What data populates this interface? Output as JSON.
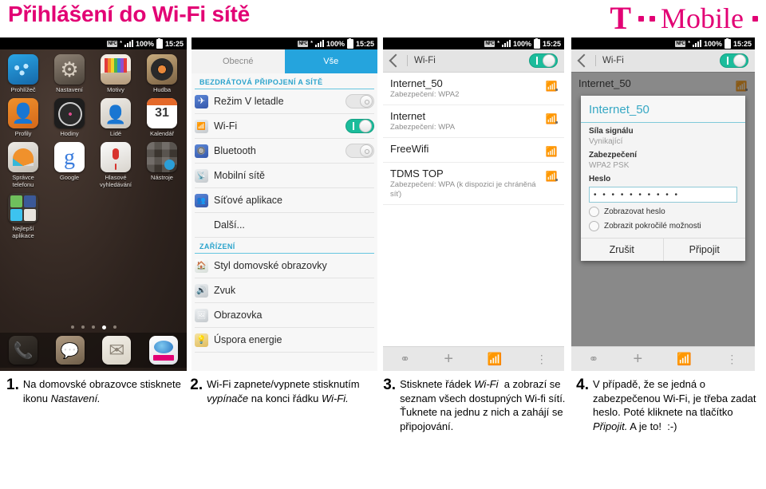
{
  "header": {
    "title": "Přihlášení do Wi-Fi sítě",
    "brand": {
      "letter": "T",
      "word": "Mobile"
    }
  },
  "statusbar": {
    "nfc": "NFC",
    "star": "*",
    "battery": "100%",
    "time": "15:25"
  },
  "phone1": {
    "apps": [
      {
        "label": "Prohlížeč",
        "icon": "browser-icon"
      },
      {
        "label": "Nastavení",
        "icon": "settings-icon"
      },
      {
        "label": "Motivy",
        "icon": "themes-icon"
      },
      {
        "label": "Hudba",
        "icon": "music-icon"
      },
      {
        "label": "Profily",
        "icon": "profiles-icon"
      },
      {
        "label": "Hodiny",
        "icon": "clock-icon"
      },
      {
        "label": "Lidé",
        "icon": "people-icon"
      },
      {
        "label": "Kalendář",
        "icon": "calendar-icon"
      },
      {
        "label": "Správce telefonu",
        "icon": "phone-manager-icon"
      },
      {
        "label": "Google",
        "icon": "google-icon"
      },
      {
        "label": "Hlasové vyhledávání",
        "icon": "voice-search-icon"
      },
      {
        "label": "Nástroje",
        "icon": "tools-folder-icon"
      },
      {
        "label": "Nejlepší aplikace",
        "icon": "best-apps-folder-icon"
      }
    ],
    "dock": [
      "phone-icon",
      "messages-icon",
      "mail-icon",
      "store-icon"
    ],
    "page_dots": 5,
    "active_dot": 4
  },
  "phone2": {
    "tabs": [
      {
        "label": "Obecné",
        "active": false
      },
      {
        "label": "Vše",
        "active": true
      }
    ],
    "sections": [
      {
        "title": "BEZDRÁTOVÁ PŘIPOJENÍ A SÍTĚ",
        "rows": [
          {
            "label": "Režim V letadle",
            "icon": "airplane-icon",
            "toggle": "off"
          },
          {
            "label": "Wi-Fi",
            "icon": "wifi-icon",
            "toggle": "on"
          },
          {
            "label": "Bluetooth",
            "icon": "bluetooth-icon",
            "toggle": "off"
          },
          {
            "label": "Mobilní sítě",
            "icon": "cellular-icon",
            "toggle": "none"
          },
          {
            "label": "Síťové aplikace",
            "icon": "network-apps-icon",
            "toggle": "none"
          },
          {
            "label": "Další...",
            "icon": "none",
            "toggle": "none"
          }
        ]
      },
      {
        "title": "ZAŘÍZENÍ",
        "rows": [
          {
            "label": "Styl domovské obrazovky",
            "icon": "home-style-icon",
            "toggle": "none"
          },
          {
            "label": "Zvuk",
            "icon": "sound-icon",
            "toggle": "none"
          },
          {
            "label": "Obrazovka",
            "icon": "display-icon",
            "toggle": "none"
          },
          {
            "label": "Úspora energie",
            "icon": "battery-saver-icon",
            "toggle": "none"
          }
        ]
      }
    ]
  },
  "phone3": {
    "actionbar": {
      "title": "Wi-Fi",
      "toggle": "on"
    },
    "networks": [
      {
        "name": "Internet_50",
        "security": "Zabezpečení: WPA2",
        "locked": true
      },
      {
        "name": "Internet",
        "security": "Zabezpečení: WPA",
        "locked": true
      },
      {
        "name": "FreeWifi",
        "security": "",
        "locked": false
      },
      {
        "name": "TDMS TOP",
        "security": "Zabezpečení: WPA (k dispozici je chráněná síť)",
        "locked": true
      }
    ],
    "navbar": [
      "wps-icon",
      "add-icon",
      "scan-icon",
      "overflow-icon"
    ]
  },
  "phone4": {
    "actionbar": {
      "title": "Wi-Fi",
      "toggle": "on"
    },
    "background_network": {
      "name": "Internet_50"
    },
    "dialog": {
      "title": "Internet_50",
      "fields": [
        {
          "key": "Síla signálu",
          "value": "Vynikající"
        },
        {
          "key": "Zabezpečení",
          "value": "WPA2 PSK"
        }
      ],
      "password_label": "Heslo",
      "password_value": "• • • • • • • • • •",
      "checkboxes": [
        {
          "label": "Zobrazovat heslo",
          "checked": false
        },
        {
          "label": "Zobrazit pokročilé možnosti",
          "checked": false
        }
      ],
      "cancel": "Zrušit",
      "connect": "Připojit"
    },
    "navbar": [
      "wps-icon",
      "add-icon",
      "scan-icon",
      "overflow-icon"
    ]
  },
  "steps": [
    {
      "num": "1.",
      "html": "Na domovské obrazovce stisknete ikonu <i>Nastavení.</i>"
    },
    {
      "num": "2.",
      "html": "Wi-Fi zapnete/vypnete stisknutím <i>vypínače</i> na konci řádku <i>Wi-Fi.</i>"
    },
    {
      "num": "3.",
      "html": "Stisknete řádek <i>Wi-Fi</i>&nbsp; a zobrazí se seznam všech dostupných Wi-fi sítí. Ťuknete na jednu z nich a zahájí se připojování."
    },
    {
      "num": "4.",
      "html": "V případě, že se jedná o zabezpečenou Wi-Fi, je třeba zadat heslo. Poté kliknete na tlačítko <i>Připojit.</i> A je to!&nbsp; :-)"
    }
  ],
  "colors": {
    "brand": "#e20074",
    "accent_blue": "#25a4dd",
    "toggle_on": "#1bbc9b",
    "dialog_title": "#37a8c4"
  }
}
